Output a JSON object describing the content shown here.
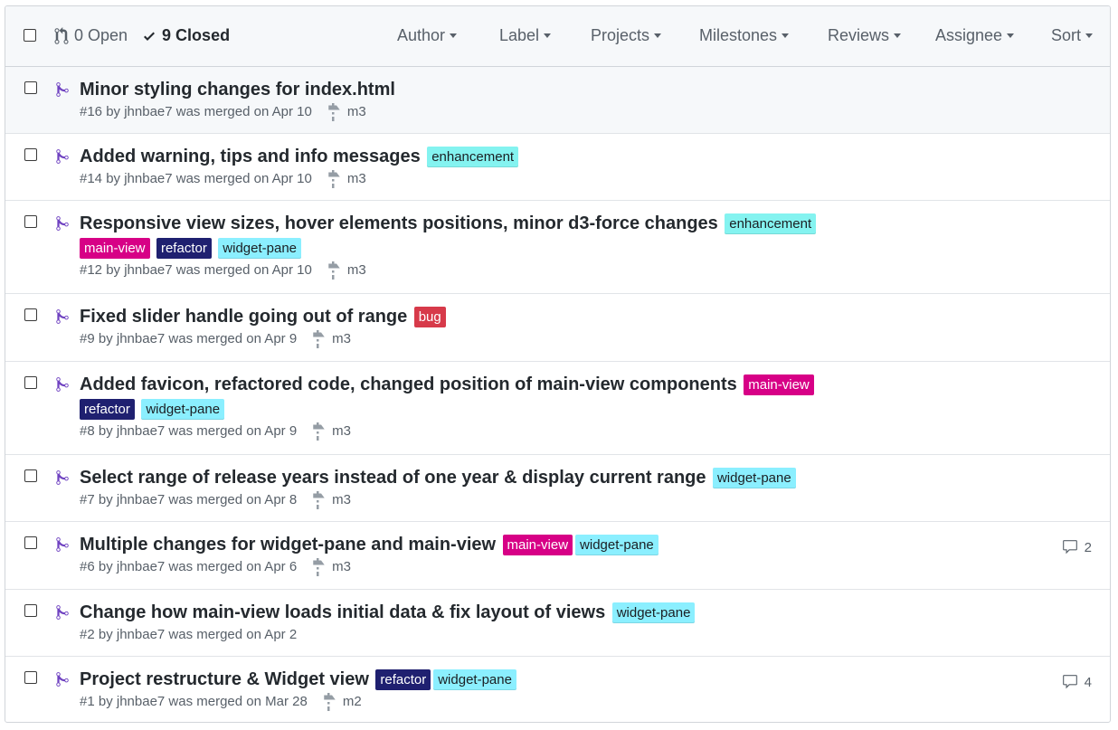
{
  "header": {
    "open_label": "0 Open",
    "closed_label": "9 Closed",
    "filters": [
      "Author",
      "Label",
      "Projects",
      "Milestones",
      "Reviews",
      "Assignee",
      "Sort"
    ]
  },
  "colors": {
    "merged_icon": "#6f42c1",
    "enhancement": "#84f3f0",
    "main-view": "#d70086",
    "refactor": "#1f2070",
    "widget-pane": "#8befff",
    "bug": "#d73a4a"
  },
  "pull_requests": [
    {
      "title": "Minor styling changes for index.html",
      "labels": [],
      "wrap_labels": [],
      "meta": "#16 by jhnbae7 was merged on Apr 10",
      "milestone": "m3",
      "comments": ""
    },
    {
      "title": "Added warning, tips and info messages",
      "labels": [
        "enhancement"
      ],
      "wrap_labels": [],
      "meta": "#14 by jhnbae7 was merged on Apr 10",
      "milestone": "m3",
      "comments": ""
    },
    {
      "title": "Responsive view sizes, hover elements positions, minor d3-force changes",
      "labels": [
        "enhancement"
      ],
      "wrap_labels": [
        "main-view",
        "refactor",
        "widget-pane"
      ],
      "meta": "#12 by jhnbae7 was merged on Apr 10",
      "milestone": "m3",
      "comments": ""
    },
    {
      "title": "Fixed slider handle going out of range",
      "labels": [
        "bug"
      ],
      "wrap_labels": [],
      "meta": "#9 by jhnbae7 was merged on Apr 9",
      "milestone": "m3",
      "comments": ""
    },
    {
      "title": "Added favicon, refactored code, changed position of main-view components",
      "labels": [
        "main-view"
      ],
      "wrap_labels": [
        "refactor",
        "widget-pane"
      ],
      "meta": "#8 by jhnbae7 was merged on Apr 9",
      "milestone": "m3",
      "comments": ""
    },
    {
      "title": "Select range of release years instead of one year & display current range",
      "labels": [
        "widget-pane"
      ],
      "wrap_labels": [],
      "meta": "#7 by jhnbae7 was merged on Apr 8",
      "milestone": "m3",
      "comments": ""
    },
    {
      "title": "Multiple changes for widget-pane and main-view",
      "labels": [
        "main-view",
        "widget-pane"
      ],
      "wrap_labels": [],
      "meta": "#6 by jhnbae7 was merged on Apr 6",
      "milestone": "m3",
      "comments": "2"
    },
    {
      "title": "Change how main-view loads initial data & fix layout of views",
      "labels": [
        "widget-pane"
      ],
      "wrap_labels": [],
      "meta": "#2 by jhnbae7 was merged on Apr 2",
      "milestone": "",
      "comments": ""
    },
    {
      "title": "Project restructure & Widget view",
      "labels": [
        "refactor",
        "widget-pane"
      ],
      "wrap_labels": [],
      "meta": "#1 by jhnbae7 was merged on Mar 28",
      "milestone": "m2",
      "comments": "4"
    }
  ]
}
